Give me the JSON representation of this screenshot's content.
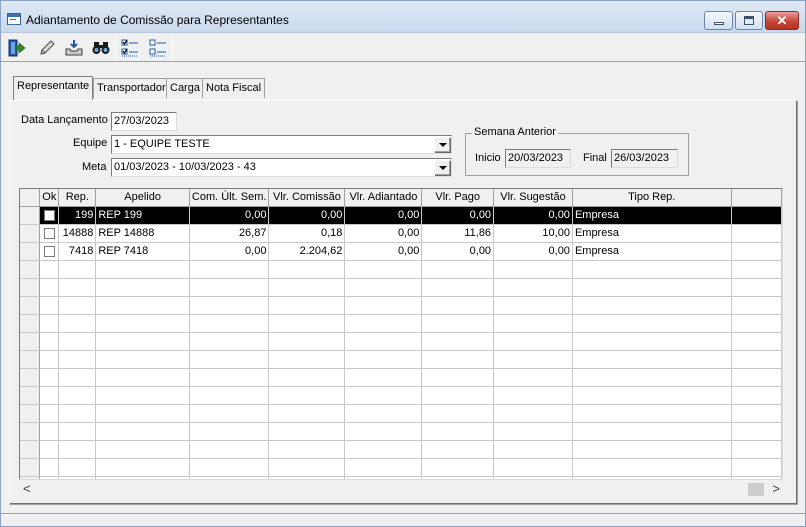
{
  "window": {
    "title": "Adiantamento de Comissão para Representantes",
    "close_glyph": "✕"
  },
  "toolbar": {
    "buttons": [
      {
        "name": "exit-door-icon"
      },
      {
        "name": "edit-pencil-icon"
      },
      {
        "name": "import-tray-icon"
      },
      {
        "name": "binoculars-search-icon"
      },
      {
        "name": "check-all-icon"
      },
      {
        "name": "uncheck-all-icon"
      }
    ]
  },
  "tabs": [
    "Representante",
    "Transportador",
    "Carga",
    "Nota Fiscal"
  ],
  "form": {
    "data_lancamento_label": "Data Lançamento",
    "data_lancamento_value": "27/03/2023",
    "equipe_label": "Equipe",
    "equipe_value": "1 - EQUIPE TESTE",
    "meta_label": "Meta",
    "meta_value": "01/03/2023 - 10/03/2023 - 43"
  },
  "semana_anterior": {
    "title": "Semana Anterior",
    "inicio_label": "Inicio",
    "inicio_value": "20/03/2023",
    "final_label": "Final",
    "final_value": "26/03/2023"
  },
  "grid": {
    "columns": [
      "Ok",
      "Rep.",
      "Apelido",
      "Com. Últ. Sem.",
      "Vlr. Comissão",
      "Vlr. Adiantado",
      "Vlr. Pago",
      "Vlr. Sugestão",
      "Tipo Rep."
    ],
    "rows": [
      {
        "rep": "199",
        "apelido": "REP 199",
        "com_ult_sem": "0,00",
        "vlr_comissao": "0,00",
        "vlr_adiantado": "0,00",
        "vlr_pago": "0,00",
        "vlr_sugestao": "0,00",
        "tipo_rep": "Empresa"
      },
      {
        "rep": "14888",
        "apelido": "REP 14888",
        "com_ult_sem": "26,87",
        "vlr_comissao": "0,18",
        "vlr_adiantado": "0,00",
        "vlr_pago": "11,86",
        "vlr_sugestao": "10,00",
        "tipo_rep": "Empresa"
      },
      {
        "rep": "7418",
        "apelido": "REP 7418",
        "com_ult_sem": "0,00",
        "vlr_comissao": "2.204,62",
        "vlr_adiantado": "0,00",
        "vlr_pago": "0,00",
        "vlr_sugestao": "0,00",
        "tipo_rep": "Empresa"
      }
    ],
    "selected_row": 0,
    "empty_rows": 13
  },
  "scrollbar": {
    "left_arrow": "<",
    "right_arrow": ">"
  }
}
